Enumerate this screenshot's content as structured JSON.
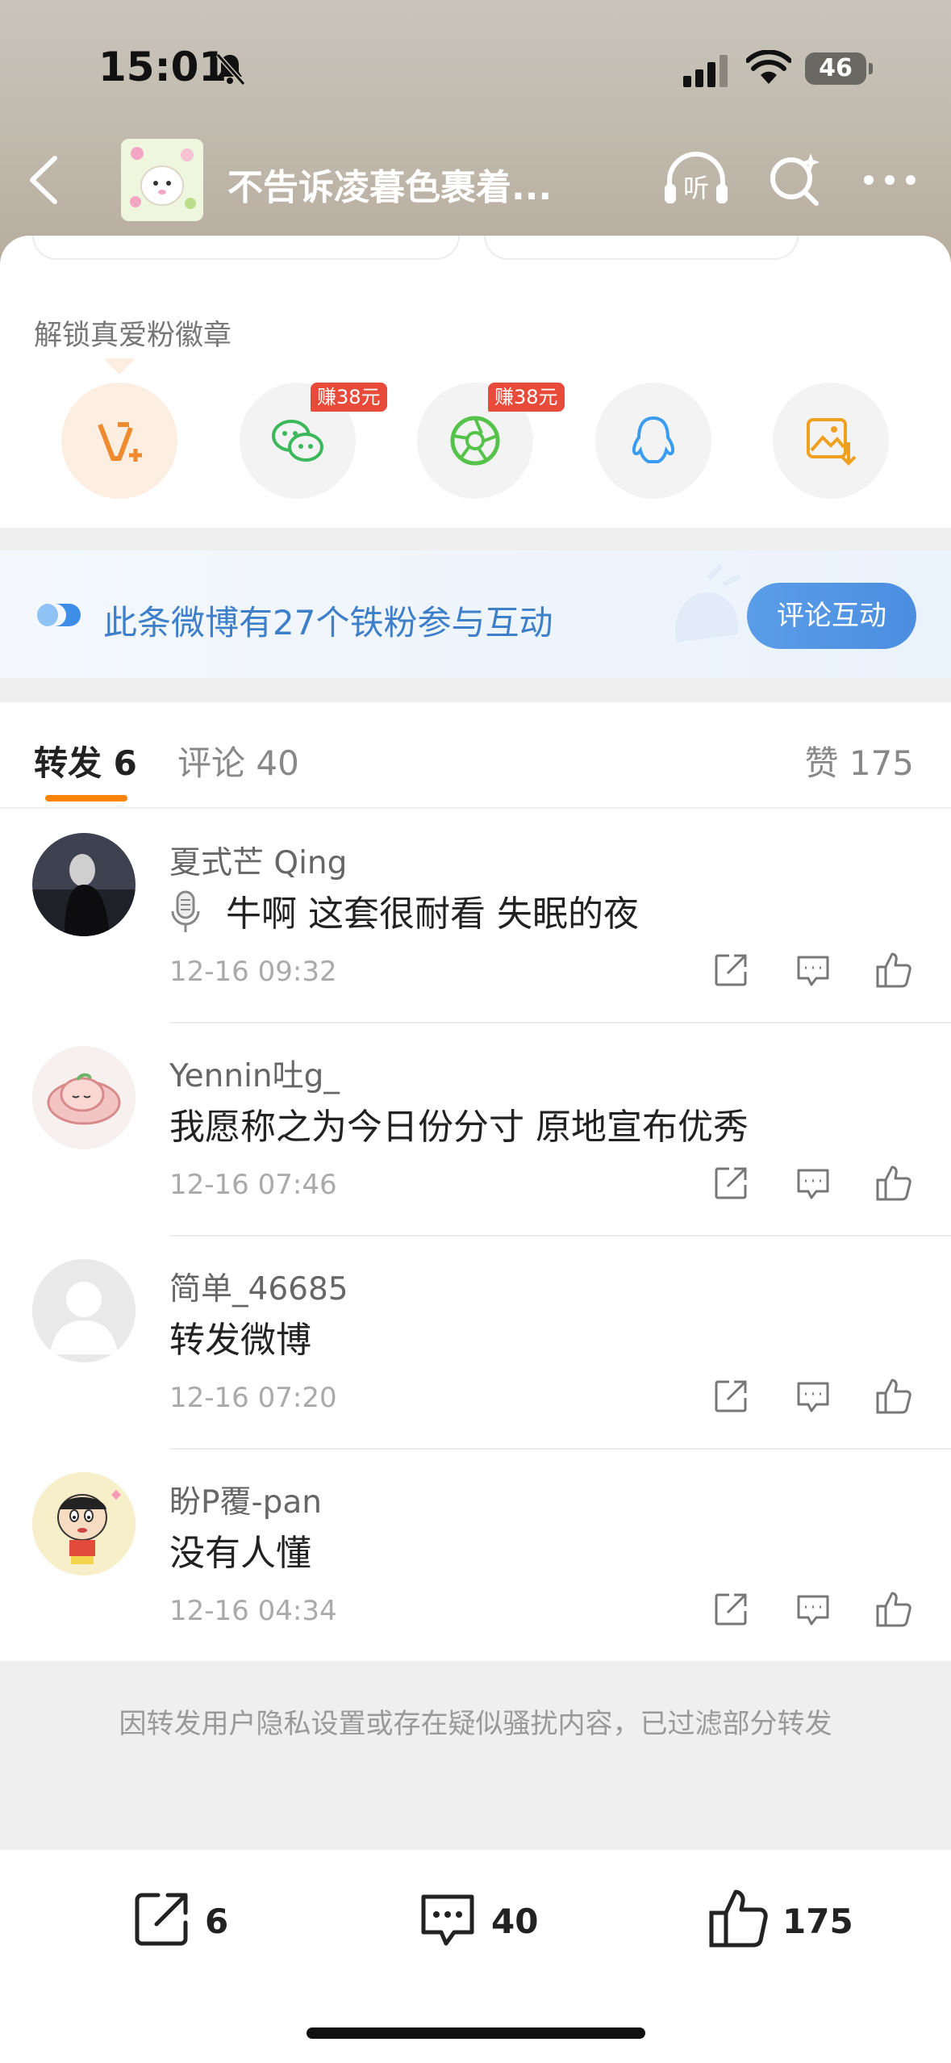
{
  "status": {
    "time": "15:01",
    "battery": "46"
  },
  "header": {
    "title": "不告诉凌暮色裹着..."
  },
  "share": {
    "unlock_label": "解锁真爱粉徽章",
    "earn_badge_wechat": "赚38元",
    "earn_badge_moments": "赚38元"
  },
  "fan_banner": {
    "text": "此条微博有27个铁粉参与互动",
    "button": "评论互动"
  },
  "tabs": {
    "repost": "转发 6",
    "comment": "评论 40",
    "like": "赞 175"
  },
  "reposts": [
    {
      "user": "夏式芒 Qing",
      "content": "牛啊 这套很耐看 失眠的夜",
      "time": "12-16 09:32"
    },
    {
      "user": "Yennin吐g_",
      "content": "我愿称之为今日份分寸 原地宣布优秀",
      "time": "12-16 07:46"
    },
    {
      "user": "简单_46685",
      "content": "转发微博",
      "time": "12-16 07:20"
    },
    {
      "user": "盼P覆-pan",
      "content": "没有人懂",
      "time": "12-16 04:34"
    }
  ],
  "notice": "因转发用户隐私设置或存在疑似骚扰内容，已过滤部分转发",
  "bottom_bar": {
    "share_count": "6",
    "comment_count": "40",
    "like_count": "175"
  },
  "colors": {
    "accent": "#ff8200",
    "link_blue": "#3e7fc9",
    "badge_red": "#e94b3b"
  }
}
